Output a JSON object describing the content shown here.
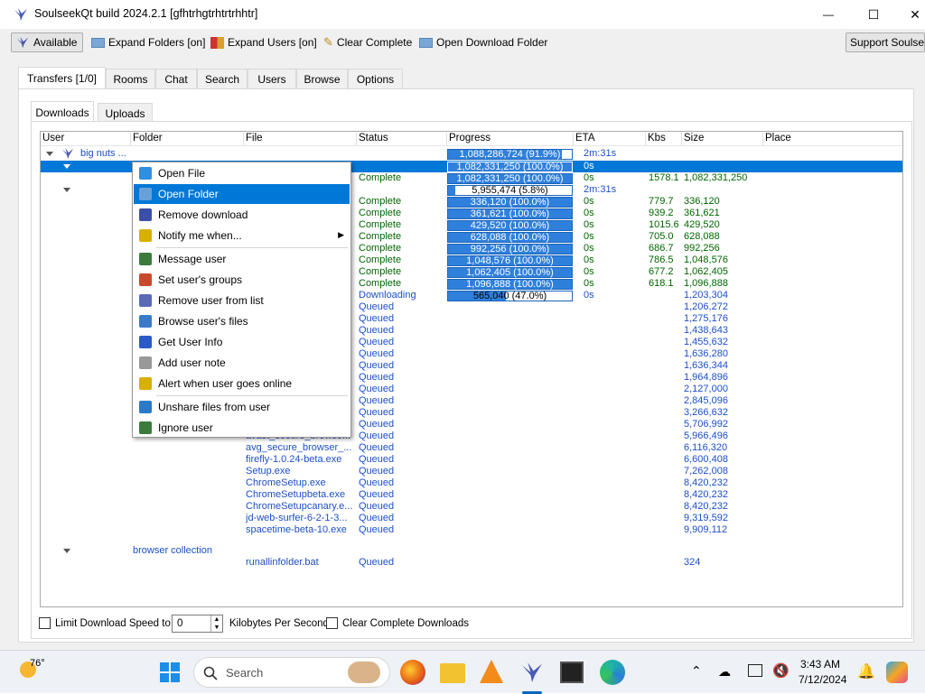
{
  "window": {
    "title": "SoulseekQt build 2024.2.1 [gfhtrhgtrhtrtrhhtr]",
    "minimize_glyph": "—",
    "maximize_glyph": "☐",
    "close_glyph": "✕"
  },
  "toolbar": {
    "available": "Available",
    "expand_folders": "Expand Folders [on]",
    "expand_users": "Expand Users [on]",
    "clear_complete": "Clear Complete",
    "open_download_folder": "Open Download Folder",
    "support": "Support Soulseek"
  },
  "main_tabs": [
    "Transfers [1/0]",
    "Rooms",
    "Chat",
    "Search",
    "Users",
    "Browse",
    "Options"
  ],
  "sub_tabs": [
    "Downloads",
    "Uploads"
  ],
  "columns": [
    "User",
    "Folder",
    "File",
    "Status",
    "Progress",
    "ETA",
    "Kbs",
    "Size",
    "Place"
  ],
  "user_row": {
    "user": "big nuts ...",
    "progress": "1,088,286,724 (91.9%)",
    "progress_fraction": 0.919,
    "eta": "2m:31s"
  },
  "rows": [
    {
      "file": "",
      "status": "",
      "progress": "1,082,331,250 (100.0%)",
      "fraction": 1.0,
      "eta": "0s",
      "kbs": "",
      "size": "",
      "selected": true,
      "kind": "sel"
    },
    {
      "file": "",
      "status": "Complete",
      "progress": "1,082,331,250 (100.0%)",
      "fraction": 1.0,
      "eta": "0s",
      "kbs": "1578.1",
      "size": "1,082,331,250",
      "kind": "complete"
    },
    {
      "file": "",
      "status": "",
      "progress": "5,955,474 (5.8%)",
      "fraction": 0.058,
      "eta": "2m:31s",
      "kbs": "",
      "size": "",
      "kind": "folder"
    },
    {
      "file": "",
      "status": "Complete",
      "progress": "336,120 (100.0%)",
      "fraction": 1.0,
      "eta": "0s",
      "kbs": "779.7",
      "size": "336,120",
      "kind": "complete"
    },
    {
      "file": "",
      "status": "Complete",
      "progress": "361,621 (100.0%)",
      "fraction": 1.0,
      "eta": "0s",
      "kbs": "939.2",
      "size": "361,621",
      "kind": "complete"
    },
    {
      "file": "",
      "status": "Complete",
      "progress": "429,520 (100.0%)",
      "fraction": 1.0,
      "eta": "0s",
      "kbs": "1015.6",
      "size": "429,520",
      "kind": "complete"
    },
    {
      "file": "",
      "status": "Complete",
      "progress": "628,088 (100.0%)",
      "fraction": 1.0,
      "eta": "0s",
      "kbs": "705.0",
      "size": "628,088",
      "kind": "complete"
    },
    {
      "file": "",
      "status": "Complete",
      "progress": "992,256 (100.0%)",
      "fraction": 1.0,
      "eta": "0s",
      "kbs": "686.7",
      "size": "992,256",
      "kind": "complete"
    },
    {
      "file": "",
      "status": "Complete",
      "progress": "1,048,576 (100.0%)",
      "fraction": 1.0,
      "eta": "0s",
      "kbs": "786.5",
      "size": "1,048,576",
      "kind": "complete"
    },
    {
      "file": "",
      "status": "Complete",
      "progress": "1,062,405 (100.0%)",
      "fraction": 1.0,
      "eta": "0s",
      "kbs": "677.2",
      "size": "1,062,405",
      "kind": "complete"
    },
    {
      "file": "",
      "status": "Complete",
      "progress": "1,096,888 (100.0%)",
      "fraction": 1.0,
      "eta": "0s",
      "kbs": "618.1",
      "size": "1,096,888",
      "kind": "complete"
    },
    {
      "file": "",
      "status": "Downloading",
      "progress": "565,040 (47.0%)",
      "fraction": 0.47,
      "eta": "0s",
      "kbs": "",
      "size": "1,203,304",
      "kind": "downloading"
    },
    {
      "file": "",
      "status": "Queued",
      "size": "1,206,272",
      "kind": "queued"
    },
    {
      "file": "",
      "status": "Queued",
      "size": "1,275,176",
      "kind": "queued"
    },
    {
      "file": "",
      "status": "Queued",
      "size": "1,438,643",
      "kind": "queued"
    },
    {
      "file": "",
      "status": "Queued",
      "size": "1,455,632",
      "kind": "queued"
    },
    {
      "file": "",
      "status": "Queued",
      "size": "1,636,280",
      "kind": "queued"
    },
    {
      "file": "",
      "status": "Queued",
      "size": "1,636,344",
      "kind": "queued"
    },
    {
      "file": "",
      "status": "Queued",
      "size": "1,964,896",
      "kind": "queued"
    },
    {
      "file": "",
      "status": "Queued",
      "size": "2,127,000",
      "kind": "queued"
    },
    {
      "file": "",
      "status": "Queued",
      "size": "2,845,096",
      "kind": "queued"
    },
    {
      "file": "",
      "status": "Queued",
      "size": "3,266,632",
      "kind": "queued"
    },
    {
      "file": "",
      "status": "Queued",
      "size": "5,706,992",
      "kind": "queued"
    },
    {
      "file": "avast_secure_browse...",
      "status": "Queued",
      "size": "5,966,496",
      "kind": "queued"
    },
    {
      "file": "avg_secure_browser_...",
      "status": "Queued",
      "size": "6,116,320",
      "kind": "queued"
    },
    {
      "file": "firefly-1.0.24-beta.exe",
      "status": "Queued",
      "size": "6,600,408",
      "kind": "queued"
    },
    {
      "file": "Setup.exe",
      "status": "Queued",
      "size": "7,262,008",
      "kind": "queued"
    },
    {
      "file": "ChromeSetup.exe",
      "status": "Queued",
      "size": "8,420,232",
      "kind": "queued"
    },
    {
      "file": "ChromeSetupbeta.exe",
      "status": "Queued",
      "size": "8,420,232",
      "kind": "queued"
    },
    {
      "file": "ChromeSetupcanary.e...",
      "status": "Queued",
      "size": "8,420,232",
      "kind": "queued"
    },
    {
      "file": "jd-web-surfer-6-2-1-3...",
      "status": "Queued",
      "size": "9,319,592",
      "kind": "queued"
    },
    {
      "file": "spacetime-beta-10.exe",
      "status": "Queued",
      "size": "9,909,112",
      "kind": "queued"
    }
  ],
  "folder2": {
    "name": "browser collection",
    "file": "runallinfolder.bat",
    "status": "Queued",
    "size": "324"
  },
  "context_menu": [
    {
      "label": "Open File",
      "icon": "play-icon"
    },
    {
      "label": "Open Folder",
      "icon": "folder-icon",
      "highlighted": true
    },
    {
      "label": "Remove download",
      "icon": "remove-icon"
    },
    {
      "label": "Notify me when...",
      "icon": "bulb-icon",
      "submenu": true
    },
    {
      "label": "Message user",
      "icon": "message-icon"
    },
    {
      "label": "Set user's groups",
      "icon": "groups-icon"
    },
    {
      "label": "Remove user from list",
      "icon": "remove-user-icon"
    },
    {
      "label": "Browse user's files",
      "icon": "browse-icon"
    },
    {
      "label": "Get User Info",
      "icon": "info-icon"
    },
    {
      "label": "Add user note",
      "icon": "note-icon"
    },
    {
      "label": "Alert when user goes online",
      "icon": "alert-icon"
    },
    {
      "label": "Unshare files from user",
      "icon": "unshare-icon"
    },
    {
      "label": "Ignore user",
      "icon": "ignore-icon"
    }
  ],
  "bottom": {
    "limit_label": "Limit Download Speed to",
    "speed_value": "0",
    "unit_label": "Kilobytes Per Second",
    "clear_label": "Clear Complete Downloads"
  },
  "taskbar": {
    "weather_temp": "76°",
    "search_placeholder": "Search",
    "time": "3:43 AM",
    "date": "7/12/2024"
  },
  "colors": {
    "accent": "#0078d7",
    "complete": "#006600",
    "queued": "#1c4fc7",
    "progress_fill": "#2f80dd"
  }
}
